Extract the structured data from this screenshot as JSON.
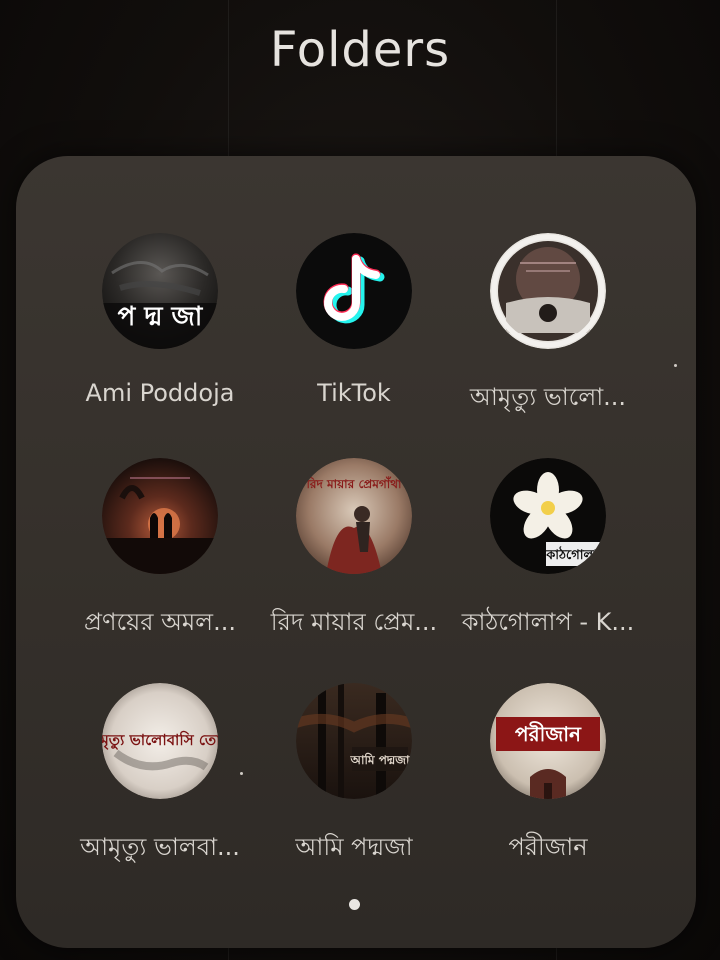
{
  "header": {
    "title": "Folders"
  },
  "apps": [
    {
      "label": "Ami Poddoja",
      "icon": "ami-poddoja-icon",
      "logo_text": "প দ্ম জা"
    },
    {
      "label": "TikTok",
      "icon": "tiktok-icon"
    },
    {
      "label": "আমৃত্যু ভালো...",
      "icon": "amrittu-bhalo-icon"
    },
    {
      "label": "প্রণয়ের অমল...",
      "icon": "pronoyer-omol-icon"
    },
    {
      "label": "রিদ মায়ার প্রেম...",
      "icon": "rid-mayar-prem-icon",
      "logo_text": "রিদ মায়ার প্রেমগাঁথা"
    },
    {
      "label": "কাঠগোলাপ - K...",
      "icon": "kathgolap-icon",
      "logo_text": "কাঠগোলাপ"
    },
    {
      "label": "আমৃত্যু ভালবা...",
      "icon": "amrittu-bhalobasi-icon",
      "logo_text": "আমৃত্যু ভালোবাসি তোকে"
    },
    {
      "label": "আমি পদ্মজা",
      "icon": "ami-poddoja-bn-icon",
      "logo_text": "আমি পদ্মজা"
    },
    {
      "label": "পরীজান",
      "icon": "porijan-icon",
      "logo_text": "পরীজান"
    }
  ],
  "pagination": {
    "current_page": 1,
    "total_pages": 1
  },
  "colors": {
    "panel": "#38332e",
    "text": "#d9d5cf",
    "title": "#e6e3df",
    "background": "#100d0b"
  }
}
